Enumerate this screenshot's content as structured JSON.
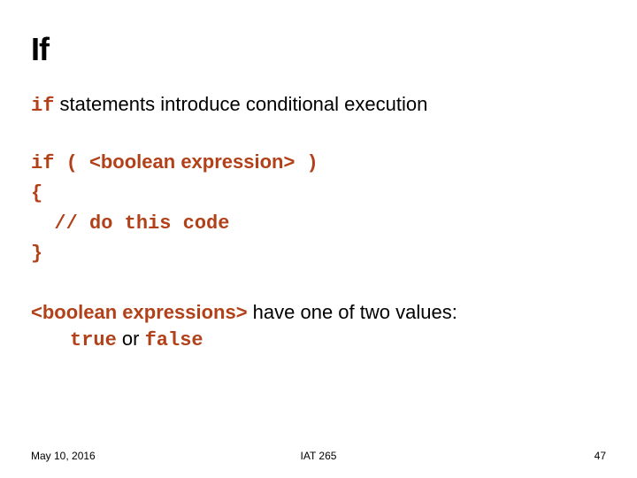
{
  "title": "If",
  "line1": {
    "code": "if",
    "rest": " statements introduce conditional execution"
  },
  "codeblock": {
    "l1a": "if ( ",
    "l1b": "<boolean expression>",
    "l1c": " )",
    "l2": "{",
    "l3": "  // do this code",
    "l4": "}"
  },
  "line2": {
    "ph": "<boolean expressions>",
    "rest": " have one of two values: ",
    "true": "true",
    "or": " or ",
    "false": "false"
  },
  "footer": {
    "date": "May 10, 2016",
    "course": "IAT 265",
    "page": "47"
  }
}
